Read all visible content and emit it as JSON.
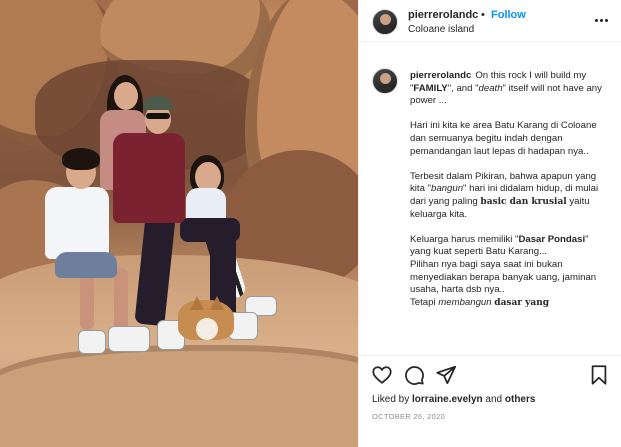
{
  "header": {
    "username": "pierrerolandc",
    "separator": "•",
    "follow_label": "Follow",
    "location": "Coloane island"
  },
  "caption": {
    "username": "pierrerolandc",
    "p1_a": "On this rock I will build my \"",
    "p1_b": "FAMILY",
    "p1_c": "\", and \"",
    "p1_d": "death",
    "p1_e": "\" itself will not have any power ...",
    "p2": "Hari ini kita ke area Batu Karang di Coloane dan semuanya begitu indah dengan pemandangan laut lepas di hadapan nya..",
    "p3_a": "Terbesit dalam Pikiran, bahwa apapun yang kita \"",
    "p3_b": "bangun",
    "p3_c": "\" hari ini didalam hidup, di mulai dari yang paling ",
    "p3_d": "basic dan krusial",
    "p3_e": " yaitu keluarga kita.",
    "p4_a": "Keluarga harus memiliki \"",
    "p4_b": "Dasar Pondasi",
    "p4_c": "\" yang kuat seperti Batu Karang...",
    "p4_d": "Pilihan nya bagi saya saat ini bukan menyediakan berapa banyak uang, jaminan usaha, harta dsb nya..",
    "p4_e": "Tetapi ",
    "p4_f": "membangun",
    "p4_g": " ",
    "p4_h": "dasar yang"
  },
  "footer": {
    "icons": [
      "heart-icon",
      "comment-icon",
      "share-icon",
      "bookmark-icon"
    ],
    "liked_prefix": "Liked by ",
    "liked_users": "lorraine.evelyn",
    "liked_and": " and ",
    "liked_others": "others",
    "date": "OCTOBER 26, 2020"
  },
  "colors": {
    "follow": "#0095f6",
    "text": "#262626",
    "muted": "#8e8e8e"
  }
}
